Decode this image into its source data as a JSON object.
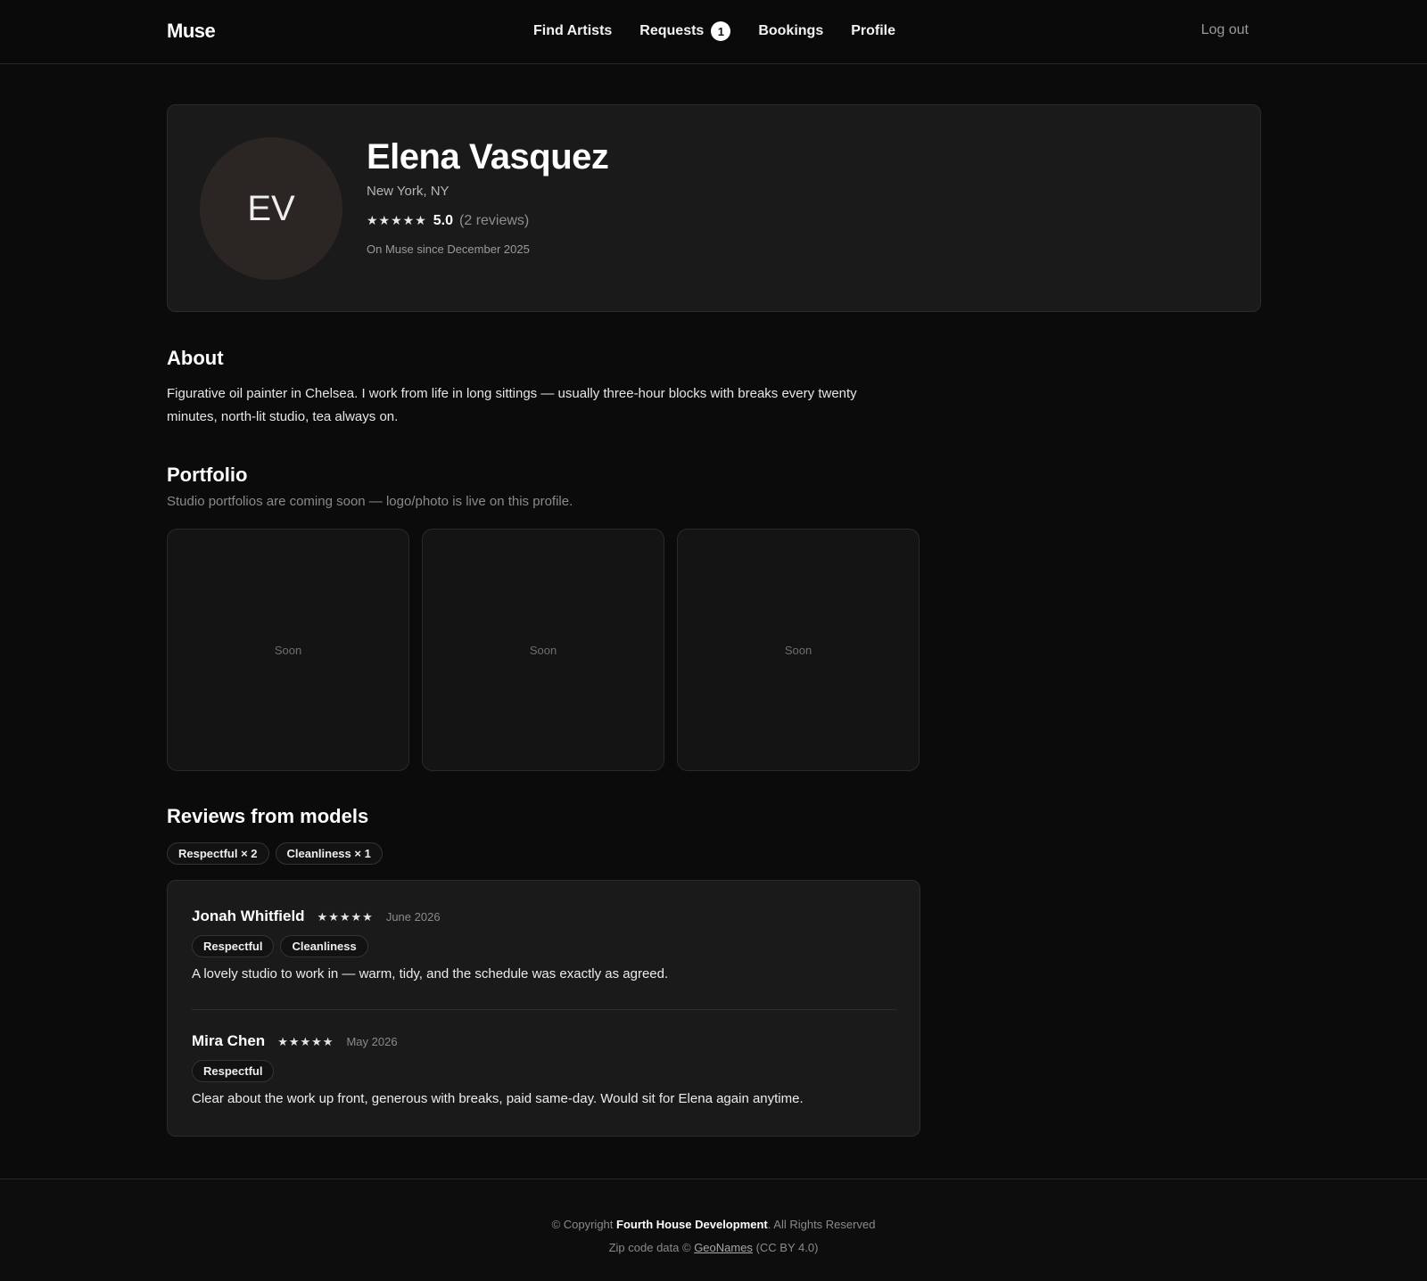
{
  "nav": {
    "logo": "Muse",
    "items": [
      {
        "label": "Find Artists"
      },
      {
        "label": "Requests",
        "badge": "1"
      },
      {
        "label": "Bookings"
      },
      {
        "label": "Profile"
      }
    ],
    "logout": "Log out"
  },
  "profile": {
    "initials": "EV",
    "name": "Elena Vasquez",
    "location": "New York, NY",
    "stars": "★★★★★",
    "rating": "5.0",
    "review_count": "(2 reviews)",
    "since": "On Muse since December 2025"
  },
  "about": {
    "title": "About",
    "text": "Figurative oil painter in Chelsea. I work from life in long sittings — usually three-hour blocks with breaks every twenty minutes, north-lit studio, tea always on."
  },
  "portfolio": {
    "title": "Portfolio",
    "subtitle": "Studio portfolios are coming soon — logo/photo is live on this profile.",
    "tiles": [
      "Soon",
      "Soon",
      "Soon"
    ]
  },
  "reviews": {
    "title": "Reviews from models",
    "summary_tags": [
      "Respectful × 2",
      "Cleanliness × 1"
    ],
    "items": [
      {
        "name": "Jonah Whitfield",
        "stars": "★★★★★",
        "date": "June 2026",
        "tags": [
          "Respectful",
          "Cleanliness"
        ],
        "text": "A lovely studio to work in — warm, tidy, and the schedule was exactly as agreed."
      },
      {
        "name": "Mira Chen",
        "stars": "★★★★★",
        "date": "May 2026",
        "tags": [
          "Respectful"
        ],
        "text": "Clear about the work up front, generous with breaks, paid same-day. Would sit for Elena again anytime."
      }
    ]
  },
  "footer": {
    "copyright_prefix": "© Copyright",
    "company": "Fourth House Development",
    "copyright_suffix": ". All Rights Reserved",
    "zip_prefix": "Zip code data ©",
    "geonames": "GeoNames",
    "license": "(CC BY 4.0)"
  }
}
